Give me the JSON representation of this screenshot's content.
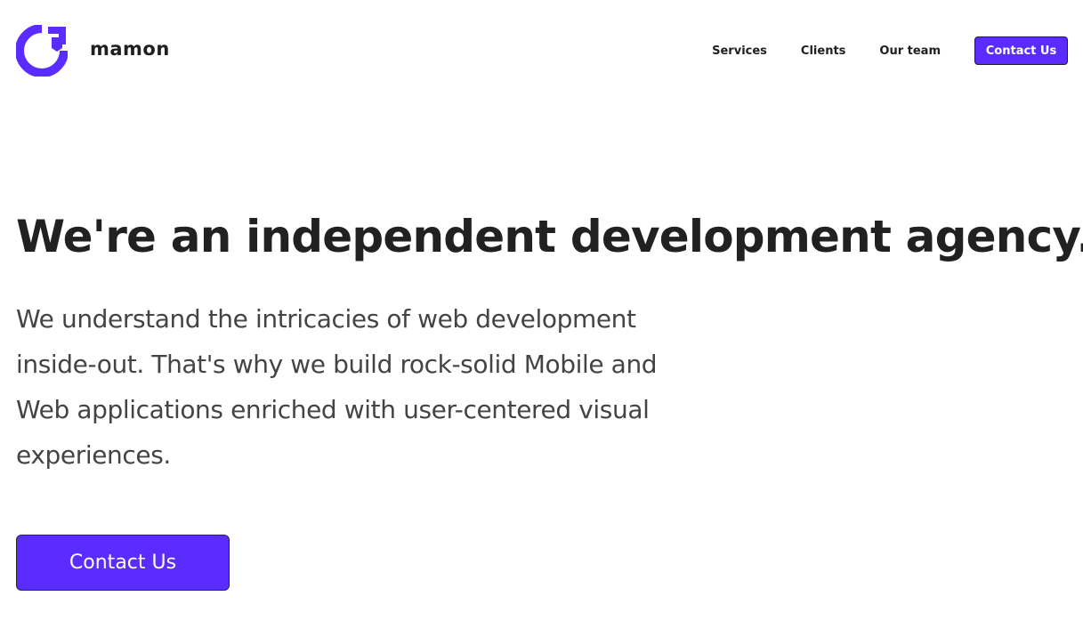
{
  "brand": {
    "name": "mamon",
    "color": "#5a2cff"
  },
  "nav": {
    "items": [
      {
        "label": "Services"
      },
      {
        "label": "Clients"
      },
      {
        "label": "Our team"
      }
    ],
    "cta_label": "Contact Us"
  },
  "hero": {
    "title": "We're an independent development agency.",
    "description": "We understand the intricacies of web development inside-out. That's why we build rock-solid Mobile and Web applications enriched with user-centered visual experiences.",
    "cta_label": "Contact Us"
  }
}
